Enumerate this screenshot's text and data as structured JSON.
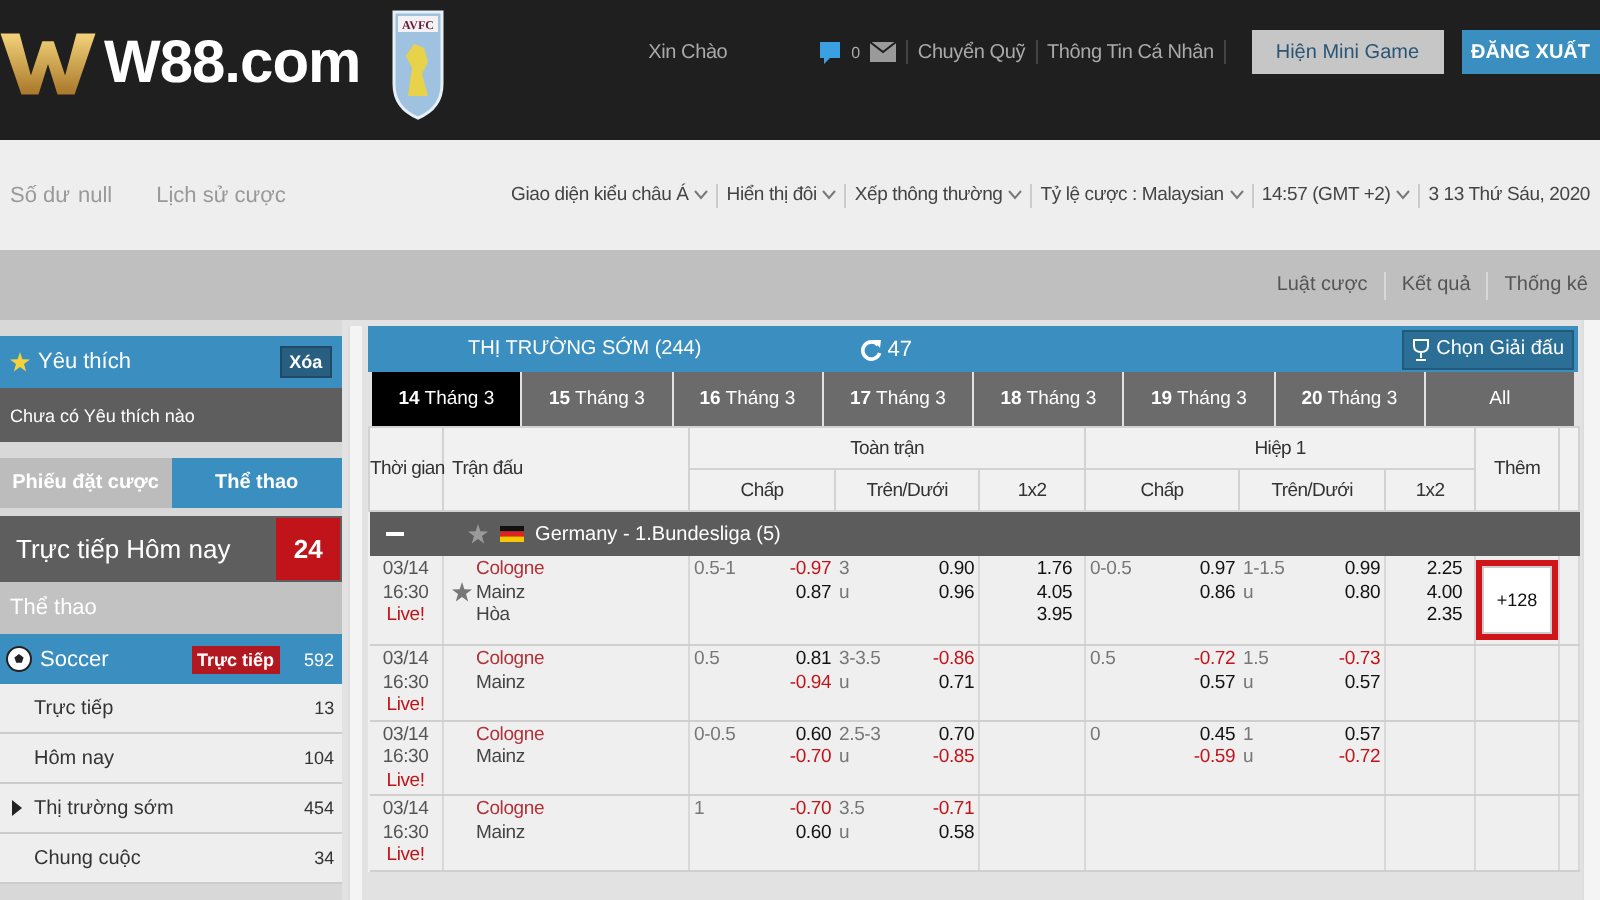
{
  "header": {
    "logo": "W88.com",
    "crest": "AVFC",
    "greeting": "Xin Chào",
    "message_count": "0",
    "links": [
      "Chuyển Quỹ",
      "Thông Tin Cá Nhân"
    ],
    "mini_game_button": "Hiện Mini Game",
    "logout_button": "ĐĂNG XUẤT"
  },
  "toolbar": {
    "balance_label": "Số dư",
    "balance_value": "null",
    "history_link": "Lịch sử cược",
    "dropdowns": [
      "Giao diện kiểu châu Á",
      "Hiển thị đôi",
      "Xếp thông thường",
      "Tỷ lệ cược :  Malaysian",
      "14:57  (GMT +2)"
    ],
    "date": "3 13 Thứ Sáu, 2020"
  },
  "sub_links": [
    "Luật cược",
    "Kết quả",
    "Thống kê"
  ],
  "sidebar": {
    "favorites": {
      "title": "Yêu thích",
      "clear_button": "Xóa",
      "empty_text": "Chưa có Yêu thích nào"
    },
    "tabs": [
      {
        "label": "Phiếu đặt cược",
        "selected": false
      },
      {
        "label": "Thể thao",
        "selected": true
      }
    ],
    "live_today": {
      "label": "Trực tiếp Hôm nay",
      "count": "24"
    },
    "section_title": "Thể thao",
    "sport": {
      "name": "Soccer",
      "live_badge": "Trực tiếp",
      "count": "592"
    },
    "items": [
      {
        "label": "Trực tiếp",
        "count": "13",
        "expandable": false
      },
      {
        "label": "Hôm nay",
        "count": "104",
        "expandable": false
      },
      {
        "label": "Thị trường sớm",
        "count": "454",
        "expandable": true
      },
      {
        "label": "Chung cuộc",
        "count": "34",
        "expandable": false
      }
    ]
  },
  "market": {
    "title": "THỊ TRƯỜNG SỚM (244)",
    "refresh_count": "47",
    "choose_league_button": "Chọn Giải đấu",
    "date_tabs": [
      {
        "label": "**14** Tháng 3",
        "selected": true
      },
      {
        "label": "**15** Tháng 3",
        "selected": false
      },
      {
        "label": "**16** Tháng 3",
        "selected": false
      },
      {
        "label": "**17** Tháng 3",
        "selected": false
      },
      {
        "label": "**18** Tháng 3",
        "selected": false
      },
      {
        "label": "**19** Tháng 3",
        "selected": false
      },
      {
        "label": "**20** Tháng 3",
        "selected": false
      },
      {
        "label": "All",
        "selected": false
      }
    ],
    "columns": {
      "time": "Thời gian",
      "match": "Trận đấu",
      "groups": [
        {
          "label": "Toàn trận",
          "subs": [
            "Chấp",
            "Trên/Dưới",
            "1x2"
          ]
        },
        {
          "label": "Hiệp 1",
          "subs": [
            "Chấp",
            "Trên/Dưới",
            "1x2"
          ]
        }
      ],
      "more": "Thêm"
    },
    "league": {
      "name": "Germany - 1.Bundesliga (5)",
      "expanded": true
    },
    "matches": [
      {
        "date": "03/14",
        "time": "16:30",
        "status": "Live!",
        "teams": [
          "Cologne",
          "Mainz",
          "Hòa"
        ],
        "favorite": true,
        "markets": [
          {
            "hdp": "0.5-1",
            "hdp_odds": [
              {
                "value": "-0.97",
                "negative": true
              },
              {
                "value": "0.87",
                "negative": false
              }
            ],
            "ou": "3",
            "ou_side": "u",
            "ou_odds": [
              {
                "value": "0.90",
                "negative": false
              },
              {
                "value": "0.96",
                "negative": false
              }
            ],
            "x12": [
              "1.76",
              "4.05",
              "3.95"
            ]
          },
          {
            "hdp": "0-0.5",
            "hdp_odds": [
              {
                "value": "0.97",
                "negative": false
              },
              {
                "value": "0.86",
                "negative": false
              }
            ],
            "ou": "1-1.5",
            "ou_side": "u",
            "ou_odds": [
              {
                "value": "0.99",
                "negative": false
              },
              {
                "value": "0.80",
                "negative": false
              }
            ],
            "x12": [
              "2.25",
              "4.00",
              "2.35"
            ]
          }
        ],
        "more": {
          "label": "+128",
          "highlighted": true
        }
      },
      {
        "date": "03/14",
        "time": "16:30",
        "status": "Live!",
        "teams": [
          "Cologne",
          "Mainz"
        ],
        "favorite": false,
        "markets": [
          {
            "hdp": "0.5",
            "hdp_odds": [
              {
                "value": "0.81",
                "negative": false
              },
              {
                "value": "-0.94",
                "negative": true
              }
            ],
            "ou": "3-3.5",
            "ou_side": "u",
            "ou_odds": [
              {
                "value": "-0.86",
                "negative": true
              },
              {
                "value": "0.71",
                "negative": false
              }
            ]
          },
          {
            "hdp": "0.5",
            "hdp_odds": [
              {
                "value": "-0.72",
                "negative": true
              },
              {
                "value": "0.57",
                "negative": false
              }
            ],
            "ou": "1.5",
            "ou_side": "u",
            "ou_odds": [
              {
                "value": "-0.73",
                "negative": true
              },
              {
                "value": "0.57",
                "negative": false
              }
            ]
          }
        ]
      },
      {
        "date": "03/14",
        "time": "16:30",
        "status": "Live!",
        "teams": [
          "Cologne",
          "Mainz"
        ],
        "favorite": false,
        "markets": [
          {
            "hdp": "0-0.5",
            "hdp_odds": [
              {
                "value": "0.60",
                "negative": false
              },
              {
                "value": "-0.70",
                "negative": true
              }
            ],
            "ou": "2.5-3",
            "ou_side": "u",
            "ou_odds": [
              {
                "value": "0.70",
                "negative": false
              },
              {
                "value": "-0.85",
                "negative": true
              }
            ]
          },
          {
            "hdp": "0",
            "hdp_odds": [
              {
                "value": "0.45",
                "negative": false
              },
              {
                "value": "-0.59",
                "negative": true
              }
            ],
            "ou": "1",
            "ou_side": "u",
            "ou_odds": [
              {
                "value": "0.57",
                "negative": false
              },
              {
                "value": "-0.72",
                "negative": true
              }
            ]
          }
        ]
      },
      {
        "date": "03/14",
        "time": "16:30",
        "status": "Live!",
        "teams": [
          "Cologne",
          "Mainz"
        ],
        "favorite": false,
        "markets": [
          {
            "hdp": "1",
            "hdp_odds": [
              {
                "value": "-0.70",
                "negative": true
              },
              {
                "value": "0.60",
                "negative": false
              }
            ],
            "ou": "3.5",
            "ou_side": "u",
            "ou_odds": [
              {
                "value": "-0.71",
                "negative": true
              },
              {
                "value": "0.58",
                "negative": false
              }
            ]
          }
        ]
      }
    ]
  }
}
